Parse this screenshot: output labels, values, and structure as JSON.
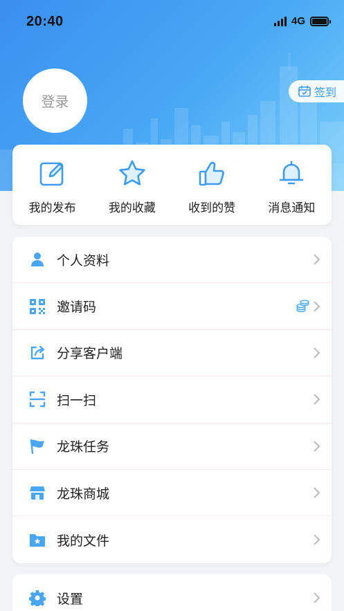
{
  "status_bar": {
    "time": "20:40",
    "network": "4G"
  },
  "profile": {
    "login_label": "登录",
    "checkin_label": "签到"
  },
  "quick_actions": [
    {
      "label": "我的发布",
      "icon": "edit-icon"
    },
    {
      "label": "我的收藏",
      "icon": "star-icon"
    },
    {
      "label": "收到的赞",
      "icon": "thumbs-up-icon"
    },
    {
      "label": "消息通知",
      "icon": "bell-icon"
    }
  ],
  "menu": [
    {
      "label": "个人资料",
      "icon": "person-icon"
    },
    {
      "label": "邀请码",
      "icon": "qr-code-icon"
    },
    {
      "label": "分享客户端",
      "icon": "share-icon"
    },
    {
      "label": "扫一扫",
      "icon": "scan-icon"
    },
    {
      "label": "龙珠任务",
      "icon": "flag-icon"
    },
    {
      "label": "龙珠商城",
      "icon": "store-icon"
    },
    {
      "label": "我的文件",
      "icon": "folder-icon"
    }
  ],
  "settings": {
    "label": "设置",
    "icon": "gear-icon"
  },
  "colors": {
    "accent": "#3d9bf0",
    "hero_start": "#3b8ff0",
    "hero_end": "#7dd0fb"
  }
}
